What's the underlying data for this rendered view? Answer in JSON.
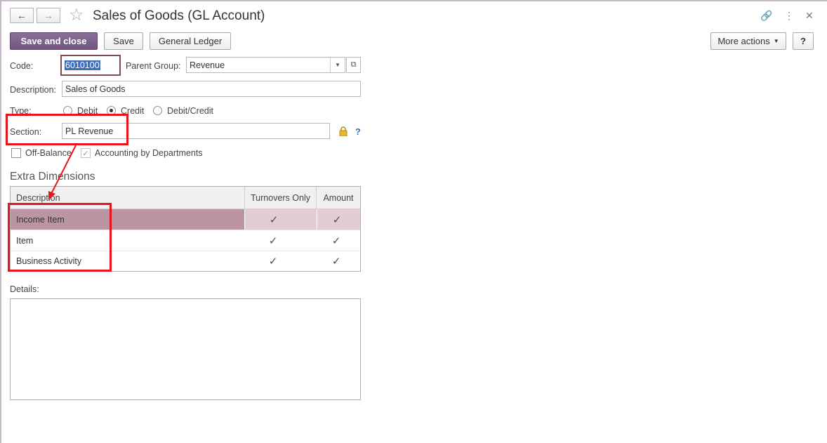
{
  "window": {
    "title": "Sales of Goods (GL Account)"
  },
  "toolbar": {
    "save_close": "Save and close",
    "save": "Save",
    "general_ledger": "General Ledger",
    "more_actions": "More actions",
    "help": "?"
  },
  "form": {
    "code_label": "Code:",
    "code_value": "6010100",
    "parent_group_label": "Parent Group:",
    "parent_group_value": "Revenue",
    "description_label": "Description:",
    "description_value": "Sales of Goods",
    "type_label": "Type:",
    "type_options": [
      "Debit",
      "Credit",
      "Debit/Credit"
    ],
    "type_selected": "Credit",
    "section_label": "Section:",
    "section_value": "PL Revenue",
    "section_help": "?",
    "off_balance_label": "Off-Balance",
    "accounting_by_departments_label": "Accounting by Departments"
  },
  "extra_dimensions": {
    "title": "Extra Dimensions",
    "columns": [
      "Description",
      "Turnovers Only",
      "Amount"
    ],
    "rows": [
      {
        "description": "Income Item",
        "turnovers_only": true,
        "amount": true
      },
      {
        "description": "Item",
        "turnovers_only": true,
        "amount": true
      },
      {
        "description": "Business Activity",
        "turnovers_only": true,
        "amount": true
      }
    ]
  },
  "details": {
    "label": "Details:"
  },
  "colors": {
    "primary_button": "#7a5f88",
    "selected_row": "#bc95a4",
    "annotation_red": "#e8141b"
  }
}
